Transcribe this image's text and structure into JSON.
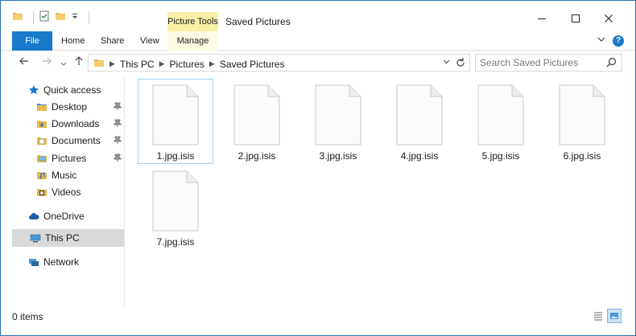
{
  "window": {
    "title": "Saved Pictures",
    "context_tab_group": "Picture Tools"
  },
  "ribbon": {
    "tabs": [
      {
        "label": "File"
      },
      {
        "label": "Home"
      },
      {
        "label": "Share"
      },
      {
        "label": "View"
      },
      {
        "label": "Manage"
      }
    ]
  },
  "address": {
    "crumbs": [
      "This PC",
      "Pictures",
      "Saved Pictures"
    ]
  },
  "search": {
    "placeholder": "Search Saved Pictures"
  },
  "navpane": {
    "items": [
      {
        "label": "Quick access",
        "icon": "star-icon"
      },
      {
        "label": "Desktop",
        "icon": "folder-icon",
        "pinned": true
      },
      {
        "label": "Downloads",
        "icon": "download-folder-icon",
        "pinned": true
      },
      {
        "label": "Documents",
        "icon": "documents-folder-icon",
        "pinned": true
      },
      {
        "label": "Pictures",
        "icon": "pictures-folder-icon",
        "pinned": true
      },
      {
        "label": "Music",
        "icon": "music-folder-icon"
      },
      {
        "label": "Videos",
        "icon": "videos-folder-icon"
      },
      {
        "label": "OneDrive",
        "icon": "cloud-icon"
      },
      {
        "label": "This PC",
        "icon": "computer-icon",
        "selected": true
      },
      {
        "label": "Network",
        "icon": "network-icon"
      }
    ]
  },
  "files": [
    {
      "name": "1.jpg.isis",
      "selected": true
    },
    {
      "name": "2.jpg.isis"
    },
    {
      "name": "3.jpg.isis"
    },
    {
      "name": "4.jpg.isis"
    },
    {
      "name": "5.jpg.isis"
    },
    {
      "name": "6.jpg.isis"
    },
    {
      "name": "7.jpg.isis"
    }
  ],
  "status": {
    "items_text": "0 items"
  },
  "colors": {
    "accent": "#1979ca",
    "context_tab": "#f7f1a8",
    "selection_border": "#99d1ff",
    "nav_selected": "#d9d9d9"
  }
}
